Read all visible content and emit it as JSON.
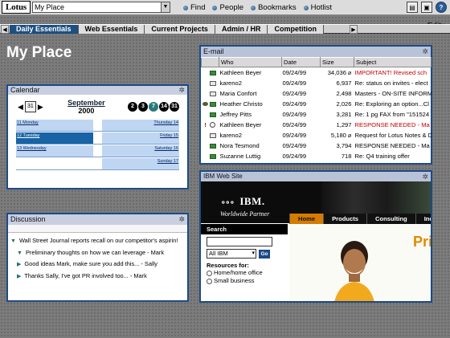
{
  "topbar": {
    "logo_text": "Lotus",
    "place_select_value": "My Place",
    "links": [
      "Find",
      "People",
      "Bookmarks",
      "Hotlist"
    ],
    "icons": [
      "bookmark-icon",
      "screen-icon",
      "help-icon"
    ]
  },
  "tabs": {
    "items": [
      "Daily Essentials",
      "Web Essentials",
      "Current Projects",
      "Admin / HR",
      "Competition"
    ],
    "active_index": 0,
    "edit_label": "Edit"
  },
  "page_title": "My Place",
  "calendar": {
    "title": "Calendar",
    "month": "September",
    "year": "2000",
    "day_dots": [
      "2",
      "3",
      "7",
      "14",
      "31"
    ],
    "selected_dot_index": 2,
    "rows": [
      {
        "left": "11 Monday",
        "right": "Thursday 14"
      },
      {
        "left": "12 Tuesday",
        "right": "Friday 15",
        "today": true
      },
      {
        "left": "13 Wednesday",
        "right": "Saturday 16"
      },
      {
        "left": "",
        "right": "Sunday 17"
      }
    ]
  },
  "discussion": {
    "title": "Discussion",
    "threads": [
      {
        "text": "Wall Street Journal reports recall on our competitor's aspirin!",
        "level": 0,
        "expanded": true
      },
      {
        "text": "Preliminary thoughts on how we can leverage - Mark",
        "level": 1,
        "expanded": true
      },
      {
        "text": "Good ideas Mark, make sure you add this... - Sally",
        "level": 1,
        "expanded": false
      },
      {
        "text": "Thanks Sally, I've got PR involved too... - Mark",
        "level": 1,
        "expanded": false
      }
    ]
  },
  "email": {
    "title": "E-mail",
    "columns": [
      "Who",
      "Date",
      "Size",
      "Subject"
    ],
    "rows": [
      {
        "mark": "",
        "icon": "envelope-new",
        "who": "Kathleen Beyer",
        "date": "09/24/99",
        "size": "34,036",
        "attach": true,
        "subject": "IMPORTANT! Revised sch",
        "red": true
      },
      {
        "mark": "",
        "icon": "envelope-read",
        "who": "kareno2",
        "date": "09/24/99",
        "size": "6,937",
        "attach": false,
        "subject": "Re: status on invites - elect",
        "red": false
      },
      {
        "mark": "",
        "icon": "envelope-read",
        "who": "Maria Confort",
        "date": "09/24/99",
        "size": "2,498",
        "attach": false,
        "subject": "Masters - ON-SITE INFORM",
        "red": false
      },
      {
        "mark": "flag",
        "icon": "envelope-new",
        "who": "Heather Christo",
        "date": "09/24/99",
        "size": "2,026",
        "attach": false,
        "subject": "Re: Exploring an option...Cl",
        "red": false
      },
      {
        "mark": "",
        "icon": "envelope-new",
        "who": "Jeffrey Pitts",
        "date": "09/24/99",
        "size": "3,281",
        "attach": false,
        "subject": "Re: 1 pg FAX from \"151524",
        "red": false
      },
      {
        "mark": "!",
        "icon": "status-circle",
        "who": "Kathleen Beyer",
        "date": "09/24/99",
        "size": "1,297",
        "attach": false,
        "subject": "RESPONSE NEEDED - Ma",
        "red": true
      },
      {
        "mark": "",
        "icon": "envelope-read",
        "who": "kareno2",
        "date": "09/24/99",
        "size": "5,180",
        "attach": true,
        "subject": "Request for Lotus Notes & D",
        "red": false
      },
      {
        "mark": "",
        "icon": "envelope-new",
        "who": "Nora Tesmond",
        "date": "09/24/99",
        "size": "3,794",
        "attach": false,
        "subject": "RESPONSE NEEDED - Ma",
        "red": false
      },
      {
        "mark": "",
        "icon": "envelope-new",
        "who": "Suzanne Luttig",
        "date": "09/24/99",
        "size": "718",
        "attach": false,
        "subject": "Re: Q4 training offer",
        "red": false
      }
    ]
  },
  "ibm_site": {
    "title": "IBM Web Site",
    "logo_text": "IBM.",
    "partner_text": "Worldwide Partner",
    "nav": [
      "Home",
      "Products",
      "Consulting",
      "Ind"
    ],
    "active_nav_index": 0,
    "search_label": "Search",
    "scope_value": "All IBM",
    "go_label": "Go",
    "resources_label": "Resources for:",
    "resources": [
      "Home/home office",
      "Small business"
    ],
    "promo_text": "Pri"
  }
}
